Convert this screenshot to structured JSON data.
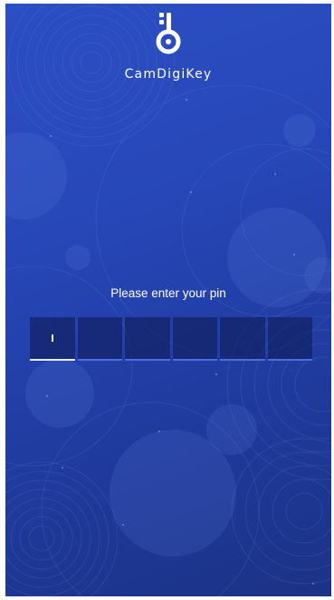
{
  "app": {
    "brand_name": "CamDigiKey",
    "logo_icon": "key-logo-icon"
  },
  "pin": {
    "prompt": "Please enter your pin",
    "length": 6,
    "filled": 0,
    "active_index": 0
  },
  "colors": {
    "background_top": "#2b4fc4",
    "background_bottom": "#1b3285",
    "pin_box": "#0c1850",
    "pin_underline": "#4a6fe0",
    "active_underline": "#e8ecff",
    "text": "#ffffff"
  }
}
